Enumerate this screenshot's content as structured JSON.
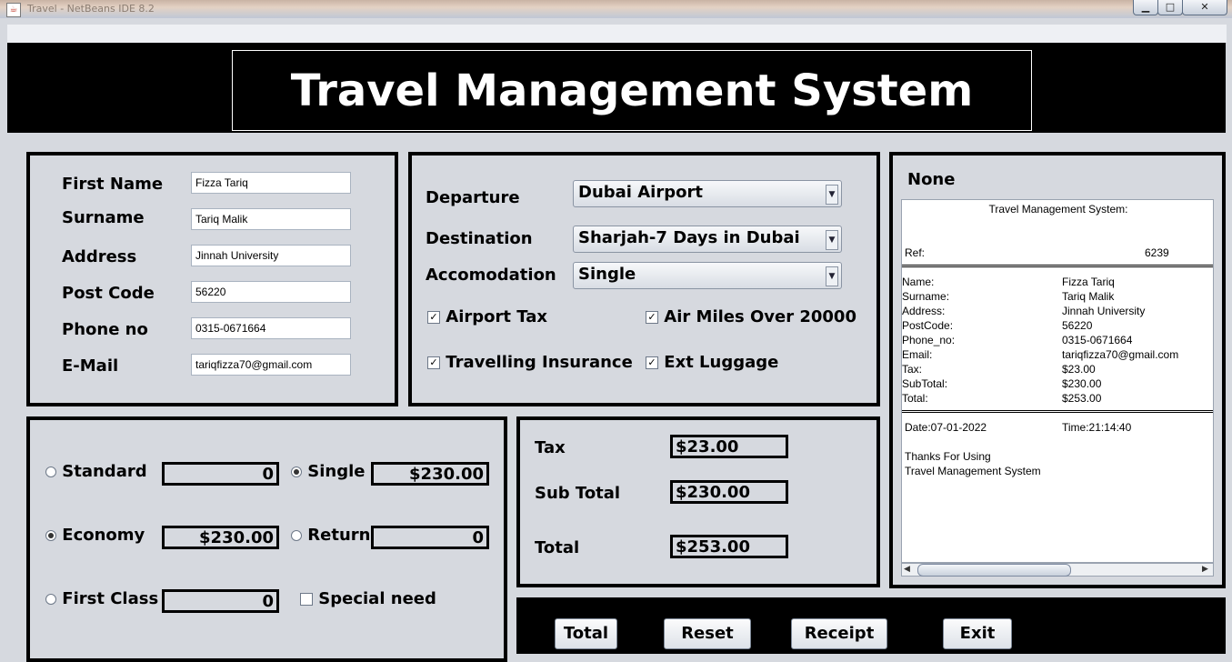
{
  "window": {
    "title": "Travel - NetBeans IDE 8.2"
  },
  "header": {
    "title": "Travel Management System"
  },
  "customer": {
    "first_name_label": "First Name",
    "first_name": "Fizza Tariq",
    "surname_label": "Surname",
    "surname": "Tariq Malik",
    "address_label": "Address",
    "address": "Jinnah University",
    "postcode_label": "Post Code",
    "postcode": "56220",
    "phone_label": "Phone no",
    "phone": "0315-0671664",
    "email_label": "E-Mail",
    "email": "tariqfizza70@gmail.com"
  },
  "trip": {
    "departure_label": "Departure",
    "departure": "Dubai Airport",
    "destination_label": "Destination",
    "destination": "Sharjah-7 Days in Dubai",
    "accommodation_label": "Accomodation",
    "accommodation": "Single",
    "airport_tax": "Airport Tax",
    "air_miles": "Air Miles Over 20000",
    "insurance": "Travelling Insurance",
    "ext_luggage": "Ext Luggage"
  },
  "fare": {
    "standard": "Standard",
    "standard_value": "0",
    "economy": "Economy",
    "economy_value": "$230.00",
    "first_class": "First Class",
    "first_class_value": "0",
    "single": "Single",
    "single_value": "$230.00",
    "return": "Return",
    "return_value": "0",
    "special_need": "Special need"
  },
  "totals": {
    "tax_label": "Tax",
    "tax": "$23.00",
    "subtotal_label": "Sub Total",
    "subtotal": "$230.00",
    "total_label": "Total",
    "total": "$253.00"
  },
  "buttons": {
    "total": "Total",
    "reset": "Reset",
    "receipt": "Receipt",
    "exit": "Exit"
  },
  "receipt": {
    "label": "None",
    "title": "Travel Management System:",
    "ref_label": "Ref:",
    "ref": "6239",
    "sep": "==========================================",
    "rows": [
      {
        "k": "Name:",
        "v": "Fizza Tariq"
      },
      {
        "k": "Surname:",
        "v": "Tariq Malik"
      },
      {
        "k": "Address:",
        "v": "Jinnah University"
      },
      {
        "k": "PostCode:",
        "v": "56220"
      },
      {
        "k": "Phone_no:",
        "v": "0315-0671664"
      },
      {
        "k": "Email:",
        "v": "tariqfizza70@gmail.com"
      },
      {
        "k": "Tax:",
        "v": "$23.00"
      },
      {
        "k": "SubTotal:",
        "v": "$230.00"
      },
      {
        "k": "Total:",
        "v": "$253.00"
      }
    ],
    "date": "Date:07-01-2022",
    "time": "Time:21:14:40",
    "thanks1": "Thanks For Using",
    "thanks2": "Travel Management System"
  }
}
